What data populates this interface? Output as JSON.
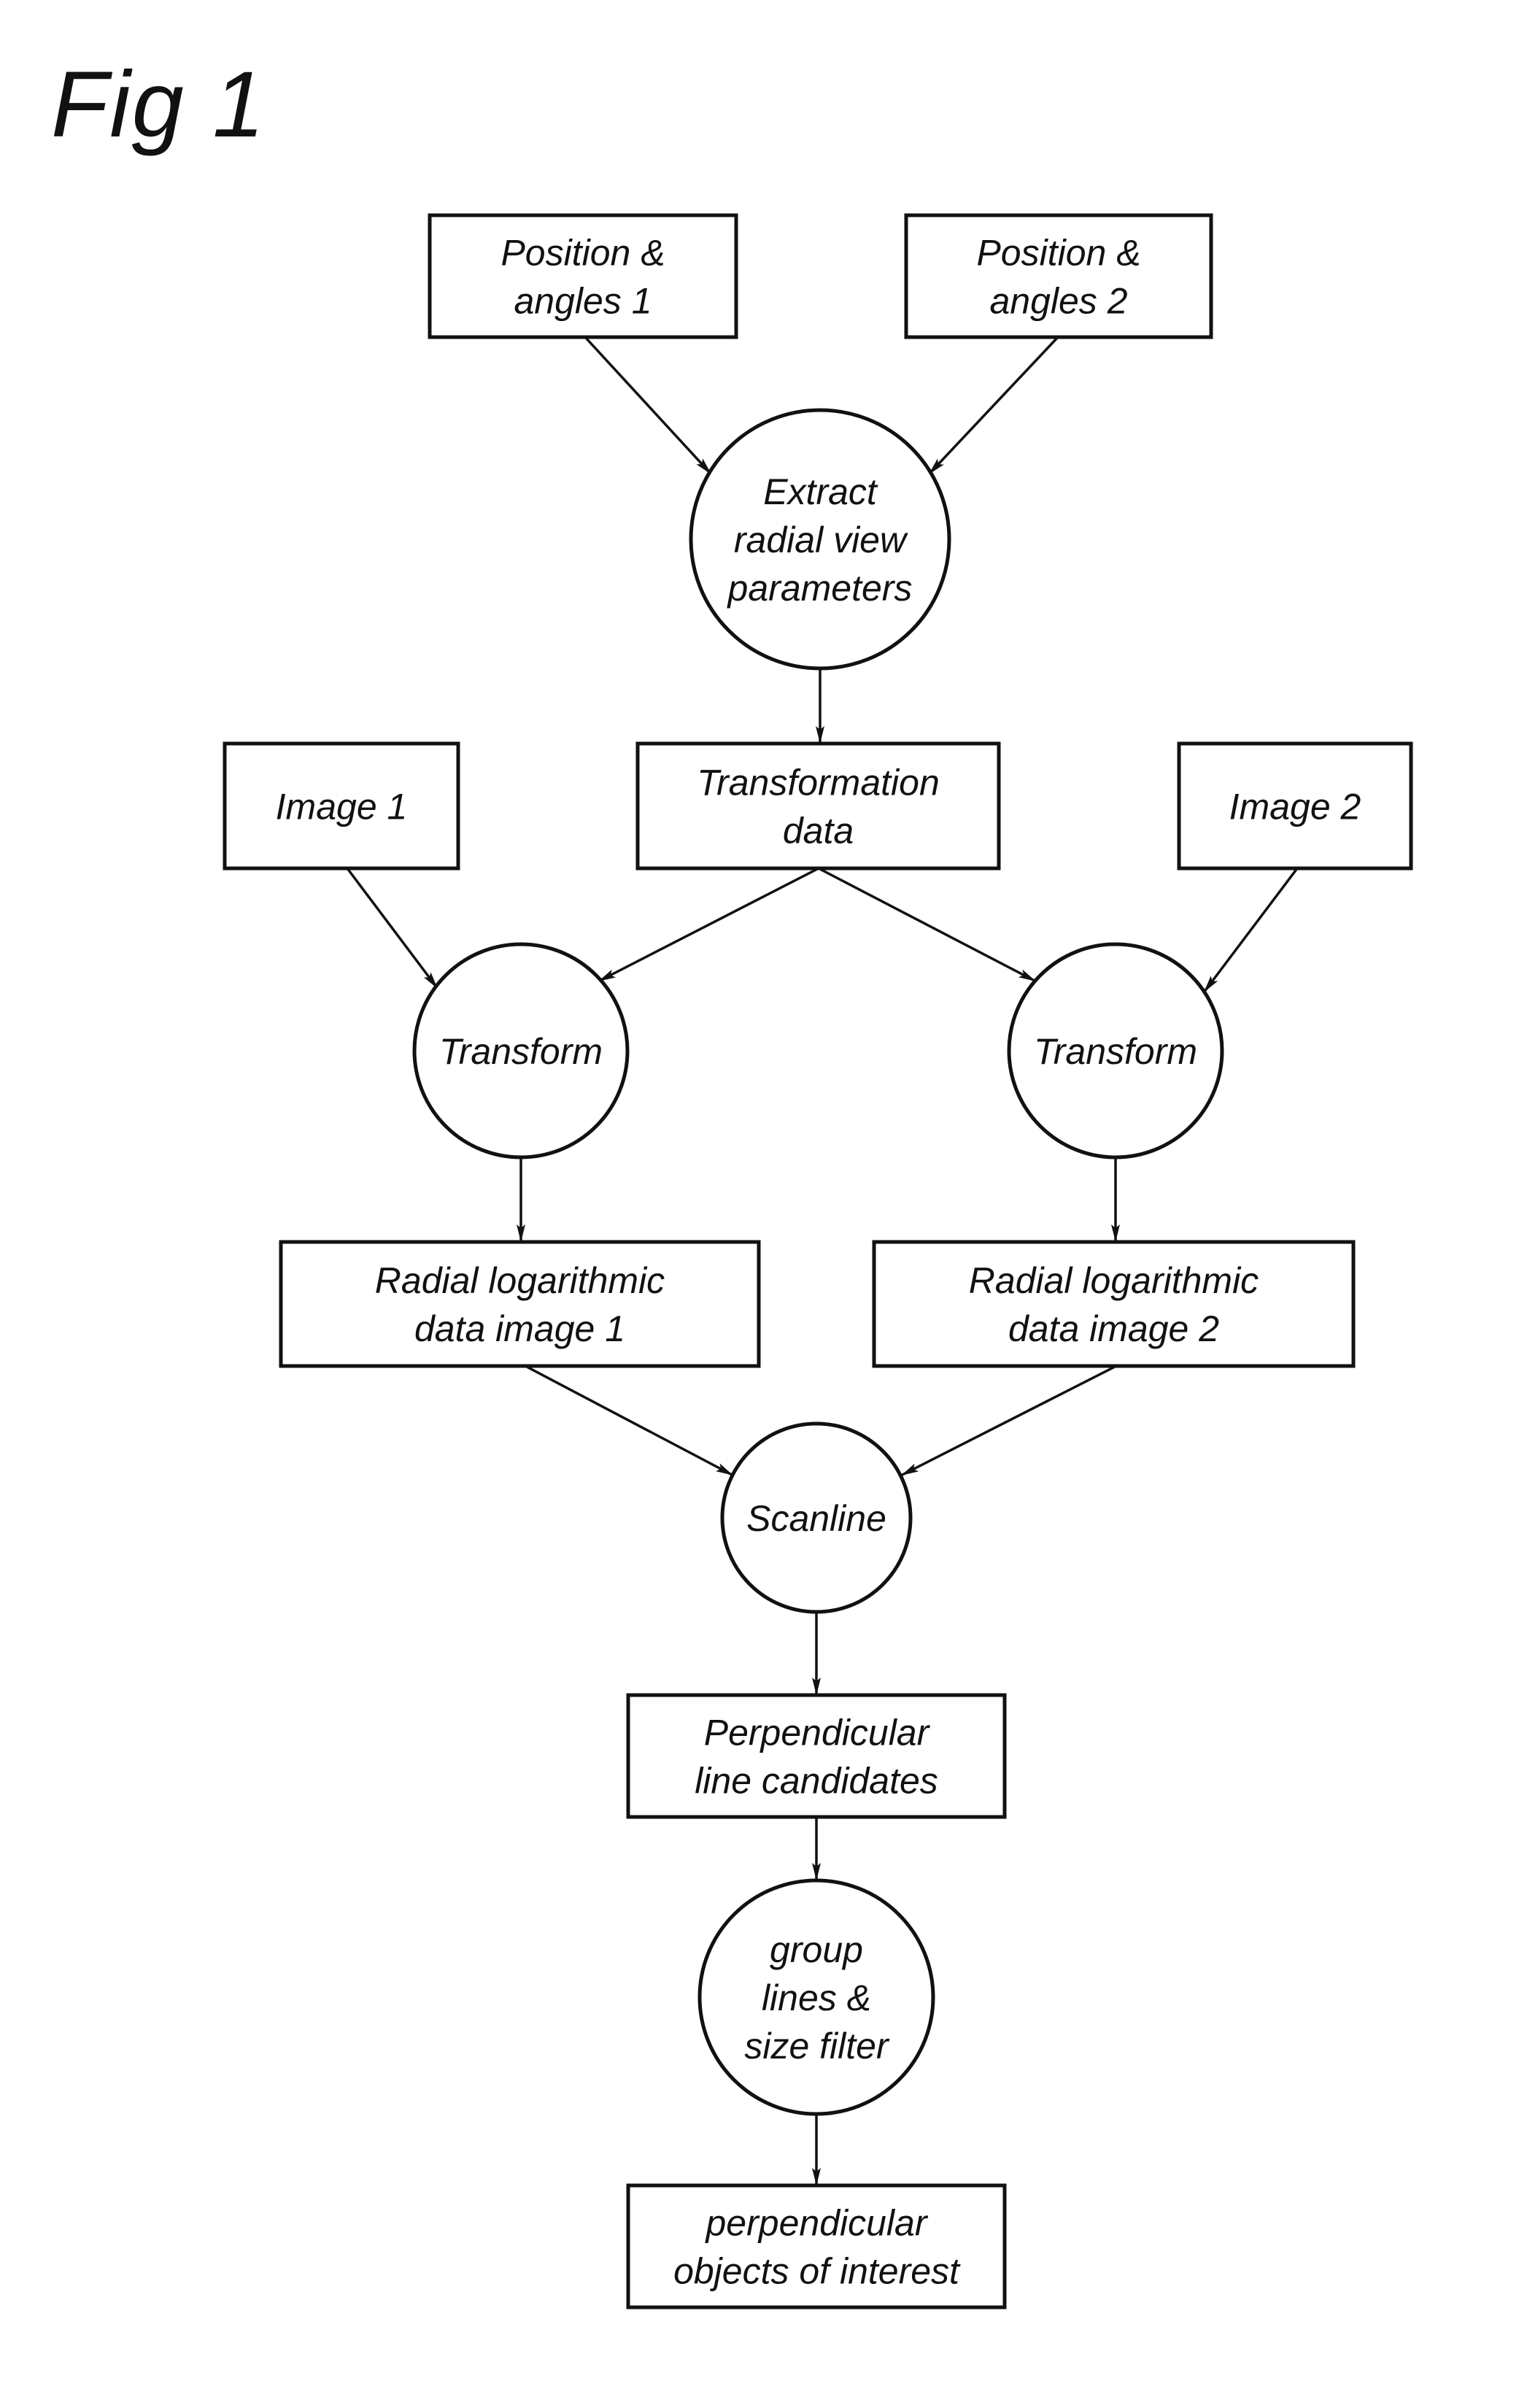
{
  "figure": {
    "title": "Fig 1"
  },
  "nodes": [
    {
      "id": "pos1",
      "shape": "rect",
      "lines": [
        "Position &",
        "angles 1"
      ]
    },
    {
      "id": "pos2",
      "shape": "rect",
      "lines": [
        "Position &",
        "angles 2"
      ]
    },
    {
      "id": "extract",
      "shape": "circle",
      "lines": [
        "Extract",
        "radial view",
        "parameters"
      ]
    },
    {
      "id": "image1",
      "shape": "rect",
      "lines": [
        "Image 1"
      ]
    },
    {
      "id": "transdata",
      "shape": "rect",
      "lines": [
        "Transformation",
        "data"
      ]
    },
    {
      "id": "image2",
      "shape": "rect",
      "lines": [
        "Image 2"
      ]
    },
    {
      "id": "transform1",
      "shape": "circle",
      "lines": [
        "Transform"
      ]
    },
    {
      "id": "transform2",
      "shape": "circle",
      "lines": [
        "Transform"
      ]
    },
    {
      "id": "radial1",
      "shape": "rect",
      "lines": [
        "Radial logarithmic",
        "data image 1"
      ]
    },
    {
      "id": "radial2",
      "shape": "rect",
      "lines": [
        "Radial logarithmic",
        "data image 2"
      ]
    },
    {
      "id": "scanline",
      "shape": "circle",
      "lines": [
        "Scanline"
      ]
    },
    {
      "id": "perpcand",
      "shape": "rect",
      "lines": [
        "Perpendicular",
        "line candidates"
      ]
    },
    {
      "id": "group",
      "shape": "circle",
      "lines": [
        "group",
        "lines &",
        "size filter"
      ]
    },
    {
      "id": "objects",
      "shape": "rect",
      "lines": [
        "perpendicular",
        "objects of interest"
      ]
    }
  ],
  "edges": [
    {
      "from": "pos1",
      "to": "extract"
    },
    {
      "from": "pos2",
      "to": "extract"
    },
    {
      "from": "extract",
      "to": "transdata"
    },
    {
      "from": "image1",
      "to": "transform1"
    },
    {
      "from": "transdata",
      "to": "transform1"
    },
    {
      "from": "transdata",
      "to": "transform2"
    },
    {
      "from": "image2",
      "to": "transform2"
    },
    {
      "from": "transform1",
      "to": "radial1"
    },
    {
      "from": "transform2",
      "to": "radial2"
    },
    {
      "from": "radial1",
      "to": "scanline"
    },
    {
      "from": "radial2",
      "to": "scanline"
    },
    {
      "from": "scanline",
      "to": "perpcand"
    },
    {
      "from": "perpcand",
      "to": "group"
    },
    {
      "from": "group",
      "to": "objects"
    }
  ]
}
